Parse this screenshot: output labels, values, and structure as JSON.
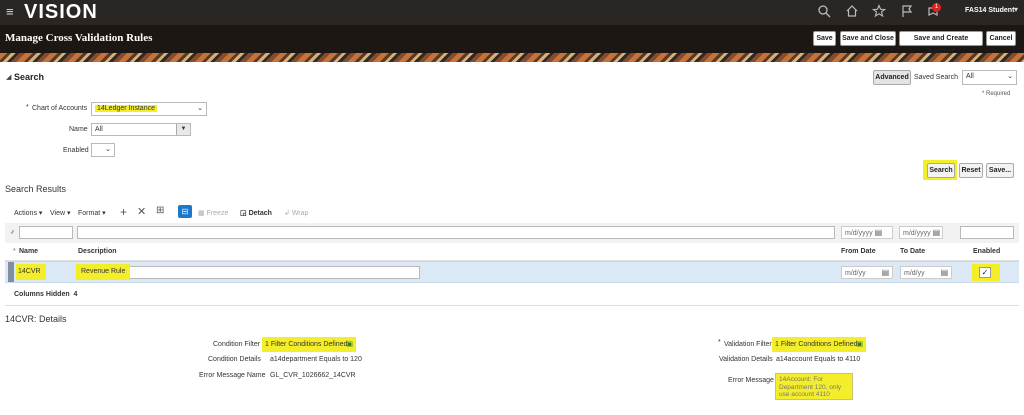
{
  "app": {
    "brand": "VISION",
    "user": "FAS14 Student",
    "notifications": "1"
  },
  "page": {
    "title": "Manage Cross Validation Rules"
  },
  "title_buttons": {
    "save": "Save",
    "save_close": "Save and Close",
    "save_create": "Save and Create Another",
    "cancel": "Cancel"
  },
  "search": {
    "title": "Search",
    "advanced": "Advanced",
    "saved_search_label": "Saved Search",
    "saved_search_value": "All",
    "required_note": "* Required",
    "coa_label": "Chart of Accounts",
    "coa_value": "14Ledger Instance",
    "name_label": "Name",
    "name_value": "All",
    "enabled_label": "Enabled",
    "enabled_value": "",
    "btn_search": "Search",
    "btn_reset": "Reset",
    "btn_save": "Save..."
  },
  "results": {
    "title": "Search Results",
    "toolbar": {
      "actions": "Actions",
      "view": "View",
      "format": "Format",
      "freeze": "Freeze",
      "detach": "Detach",
      "wrap": "Wrap"
    },
    "filter_placeholders": {
      "from_date": "m/d/yyyy",
      "to_date": "m/d/yyyy"
    },
    "columns": {
      "name": "Name",
      "description": "Description",
      "from_date": "From Date",
      "to_date": "To Date",
      "enabled": "Enabled"
    },
    "row": {
      "name": "14CVR",
      "description": "Revenue Rule",
      "from_date": "m/d/yy",
      "to_date": "m/d/yy",
      "enabled": true
    },
    "columns_hidden_label": "Columns Hidden",
    "columns_hidden_count": "4"
  },
  "details": {
    "title": "14CVR: Details",
    "condition_filter_label": "Condition Filter",
    "condition_filter_value": "1 Filter Conditions Defined",
    "condition_details_label": "Condition Details",
    "condition_details_value": "a14department Equals to 120",
    "error_name_label": "Error Message Name",
    "error_name_value": "GL_CVR_1026662_14CVR",
    "validation_filter_label": "Validation Filter",
    "validation_filter_value": "1 Filter Conditions Defined",
    "validation_details_label": "Validation Details",
    "validation_details_value": "a14account Equals to 4110",
    "error_message_label": "Error Message",
    "error_message_value": "14Account: For Department 120, only use account 4110"
  },
  "colors": {
    "topbar": "#2a2624",
    "highlight": "#f4ee2a",
    "selected_row": "#dbe9f6"
  }
}
